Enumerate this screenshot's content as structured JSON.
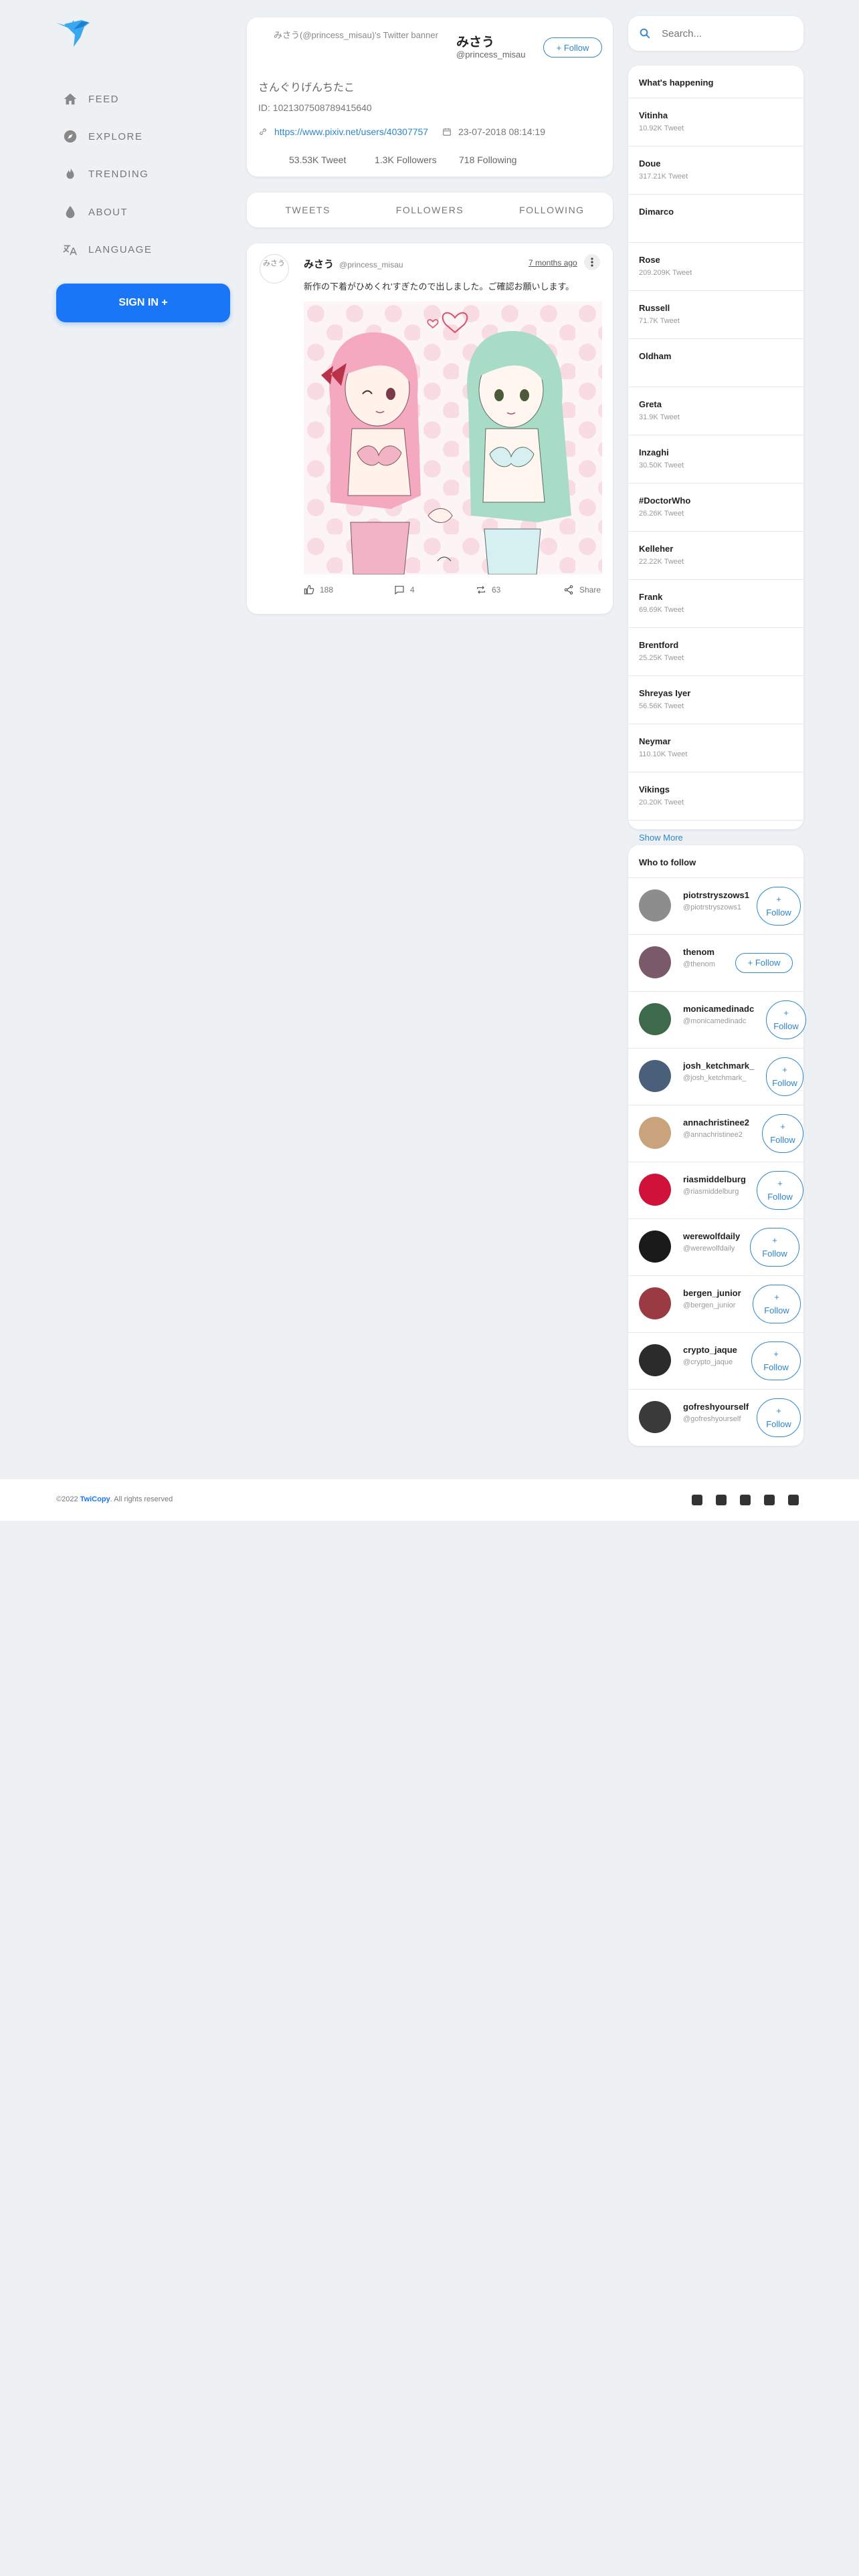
{
  "nav": {
    "items": [
      {
        "label": "FEED",
        "icon": "home-icon"
      },
      {
        "label": "EXPLORE",
        "icon": "compass-icon"
      },
      {
        "label": "TRENDING",
        "icon": "fire-icon"
      },
      {
        "label": "ABOUT",
        "icon": "drop-icon"
      },
      {
        "label": "LANGUAGE",
        "icon": "translate-icon"
      }
    ],
    "signin_label": "SIGN IN +"
  },
  "profile": {
    "banner_alt": "みさう(@princess_misau)'s Twitter banner",
    "avatar_alt": "みさう(@princess_misau)'s Twitter avatar",
    "name": "みさう",
    "handle": "@princess_misau",
    "follow_label": "+ Follow",
    "bio": "さんぐりげんちたこ",
    "id_line": "ID: 1021307508789415640",
    "link": "https://www.pixiv.net/users/40307757",
    "joined": "23-07-2018 08:14:19",
    "tweets": "53.53K Tweet",
    "followers": "1.3K Followers",
    "following": "718 Following"
  },
  "tabs": [
    "TWEETS",
    "FOLLOWERS",
    "FOLLOWING"
  ],
  "post": {
    "avatar_alt": "みさう",
    "name": "みさう",
    "handle": "@princess_misau",
    "time": "7 months ago",
    "text": "新作の下着がひめくれ'すぎたので出しました。ご確認お願いします。",
    "likes": "188",
    "comments": "4",
    "retweets": "63",
    "share_label": "Share"
  },
  "search": {
    "placeholder": "Search..."
  },
  "trends": {
    "title": "What's happening",
    "items": [
      {
        "name": "Vitinha",
        "count": "10.92K Tweet"
      },
      {
        "name": "Doue",
        "count": "317.21K Tweet"
      },
      {
        "name": "Dimarco",
        "count": ""
      },
      {
        "name": "Rose",
        "count": "209.209K Tweet"
      },
      {
        "name": "Russell",
        "count": "71.7K Tweet"
      },
      {
        "name": "Oldham",
        "count": ""
      },
      {
        "name": "Greta",
        "count": "31.9K Tweet"
      },
      {
        "name": "Inzaghi",
        "count": "30.50K Tweet"
      },
      {
        "name": "#DoctorWho",
        "count": "26.26K Tweet"
      },
      {
        "name": "Kelleher",
        "count": "22.22K Tweet"
      },
      {
        "name": "Frank",
        "count": "69.69K Tweet"
      },
      {
        "name": "Brentford",
        "count": "25.25K Tweet"
      },
      {
        "name": "Shreyas Iyer",
        "count": "56.56K Tweet"
      },
      {
        "name": "Neymar",
        "count": "110.10K Tweet"
      },
      {
        "name": "Vikings",
        "count": "20.20K Tweet"
      }
    ],
    "show_more": "Show More"
  },
  "who": {
    "title": "Who to follow",
    "follow_label": "+ Follow",
    "items": [
      {
        "name": "piotrstryszows1",
        "handle": "@piotrstryszows1",
        "color": "#8d8d8d"
      },
      {
        "name": "thenom",
        "handle": "@thenom",
        "color": "#7a5a6a"
      },
      {
        "name": "monicamedinadc",
        "handle": "@monicamedinadc",
        "color": "#3d6a4a"
      },
      {
        "name": "josh_ketchmark_",
        "handle": "@josh_ketchmark_",
        "color": "#4a5f7a"
      },
      {
        "name": "annachristinee2",
        "handle": "@annachristinee2",
        "color": "#c9a37b"
      },
      {
        "name": "riasmiddelburg",
        "handle": "@riasmiddelburg",
        "color": "#d0123a"
      },
      {
        "name": "werewolfdaily",
        "handle": "@werewolfdaily",
        "color": "#1a1a1a"
      },
      {
        "name": "bergen_junior",
        "handle": "@bergen_junior",
        "color": "#9a3b44"
      },
      {
        "name": "crypto_jaque",
        "handle": "@crypto_jaque",
        "color": "#2b2b2b"
      },
      {
        "name": "gofreshyourself",
        "handle": "@gofreshyourself",
        "color": "#3a3a3a"
      }
    ]
  },
  "footer": {
    "prefix": "©2022 ",
    "brand": "TwiCopy",
    "suffix": ". All rights reserved",
    "social": [
      "facebook-icon",
      "twitter-icon",
      "linkedin-icon",
      "youtube-icon",
      "instagram-icon"
    ]
  },
  "colors": {
    "accent": "#1976f7",
    "link": "#2e86c9",
    "background": "#eef1f4"
  }
}
